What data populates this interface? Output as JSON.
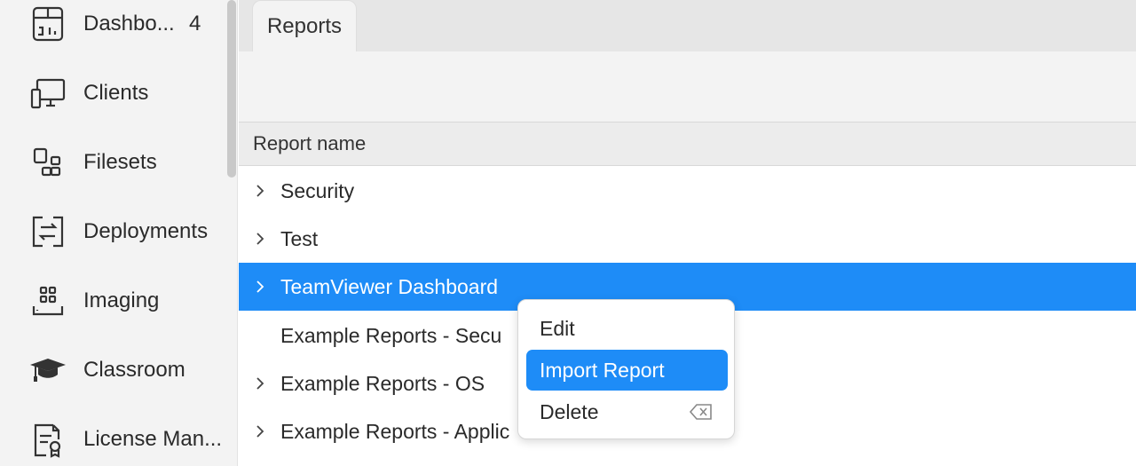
{
  "sidebar": {
    "items": [
      {
        "label": "Dashbo...",
        "badge": "4",
        "icon": "dashboard-icon"
      },
      {
        "label": "Clients",
        "icon": "clients-icon"
      },
      {
        "label": "Filesets",
        "icon": "filesets-icon"
      },
      {
        "label": "Deployments",
        "icon": "deployments-icon"
      },
      {
        "label": "Imaging",
        "icon": "imaging-icon"
      },
      {
        "label": "Classroom",
        "icon": "classroom-icon"
      },
      {
        "label": "License Man...",
        "icon": "license-icon"
      }
    ]
  },
  "tabs": [
    {
      "label": "Reports"
    }
  ],
  "table": {
    "header": "Report name",
    "rows": [
      {
        "label": "Security",
        "expandable": true
      },
      {
        "label": "Test",
        "expandable": true
      },
      {
        "label": "TeamViewer Dashboard",
        "expandable": true,
        "selected": true
      },
      {
        "label": "Example Reports - Secu",
        "expandable": false
      },
      {
        "label": "Example Reports - OS",
        "expandable": true
      },
      {
        "label": "Example Reports - Applic",
        "expandable": true
      }
    ]
  },
  "context_menu": {
    "items": [
      {
        "label": "Edit"
      },
      {
        "label": "Import Report",
        "active": true
      },
      {
        "label": "Delete",
        "shortcut_icon": "delete-key-icon"
      }
    ]
  },
  "colors": {
    "accent": "#1e8cf7",
    "sidebar_bg": "#f3f3f3"
  }
}
